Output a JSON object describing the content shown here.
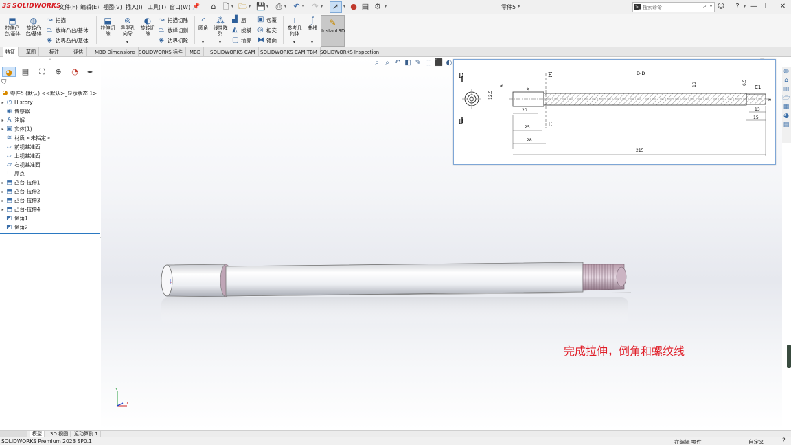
{
  "app": {
    "logo_prefix": "3S",
    "logo_text": "SOLIDWORKS"
  },
  "menu": [
    "文件(F)",
    "编辑(E)",
    "视图(V)",
    "插入(I)",
    "工具(T)",
    "窗口(W)"
  ],
  "doc_title": "零件5 *",
  "search": {
    "placeholder": "搜索命令"
  },
  "ribbon": {
    "extrude_boss": "拉伸凸\n台/基体",
    "revolve_boss": "旋转凸\n台/基体",
    "sweep": "扫描",
    "loft_boss": "放样凸台/基体",
    "boundary_boss": "边界凸台/基体",
    "extrude_cut": "拉伸切\n除",
    "hole_wizard": "异型孔\n向导",
    "revolve_cut": "旋转切\n除",
    "sweep_cut": "扫描切除",
    "loft_cut": "放样切割",
    "boundary_cut": "边界切除",
    "fillet": "圆角",
    "linear_pattern": "线性阵\n列",
    "rib": "筋",
    "draft": "拔模",
    "shell": "抽壳",
    "wrap": "包覆",
    "intersect": "相交",
    "mirror": "镜向",
    "ref_geometry": "参考几\n何体",
    "curves": "曲线",
    "instant3d": "Instant3D"
  },
  "cm_tabs": [
    "特征",
    "草图",
    "标注",
    "评估",
    "MBD Dimensions",
    "SOLIDWORKS 插件",
    "MBD",
    "SOLIDWORKS CAM",
    "SOLIDWORKS CAM TBM",
    "SOLIDWORKS Inspection"
  ],
  "tree": {
    "root": "零件5 (默认) <<默认>_显示状态 1>",
    "items": [
      "History",
      "传感器",
      "注解",
      "实体(1)",
      "材质 <未指定>",
      "前视基准面",
      "上视基准面",
      "右视基准面",
      "原点",
      "凸台-拉伸1",
      "凸台-拉伸2",
      "凸台-拉伸3",
      "凸台-拉伸4",
      "倒角1",
      "倒角2"
    ]
  },
  "drawing": {
    "section_dd": "D-D",
    "letters": [
      "D",
      "D",
      "E",
      "E"
    ],
    "dims": [
      "12.5",
      "8",
      "6",
      "20",
      "25",
      "28",
      "10",
      "6.5",
      "C1",
      "13",
      "15",
      "8",
      "215"
    ]
  },
  "annotation": "完成拉伸，倒角和螺纹线",
  "bottom_tabs": [
    "模型",
    "3D 视图",
    "运动算例 1"
  ],
  "status": {
    "left": "SOLIDWORKS Premium 2023 SP0.1",
    "editing": "在编辑 零件",
    "units": "自定义"
  }
}
